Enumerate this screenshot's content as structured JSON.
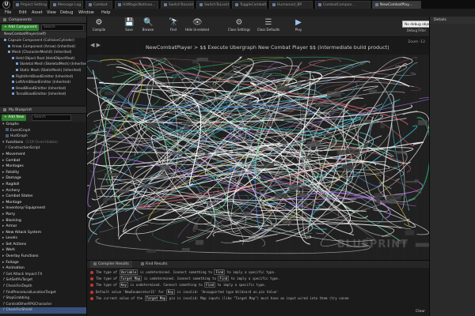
{
  "tabs": [
    {
      "label": "Project Settings",
      "active": false
    },
    {
      "label": "Message Log",
      "active": false
    },
    {
      "label": "Combat",
      "active": false
    },
    {
      "label": "HitMagicNotInvo...",
      "active": false
    },
    {
      "label": "SwitchToLockOn",
      "active": false
    },
    {
      "label": "SwitchToLockOff",
      "active": false
    },
    {
      "label": "ToggleCombatM...",
      "active": false
    },
    {
      "label": "Humanoid_BP",
      "active": false
    },
    {
      "label": "CombatCompon...",
      "active": false
    },
    {
      "label": "NewCombatPlay...",
      "active": true
    }
  ],
  "menu": [
    "File",
    "Edit",
    "Asset",
    "View",
    "Debug",
    "Window",
    "Help"
  ],
  "toolbar": [
    {
      "label": "Compile",
      "icon": "compile-icon"
    },
    {
      "label": "Save",
      "icon": "save-icon"
    },
    {
      "label": "Browse",
      "icon": "browse-icon"
    },
    {
      "label": "Find",
      "icon": "find-icon"
    },
    {
      "label": "Hide Unrelated",
      "icon": "hide-unrelated-icon"
    },
    {
      "label": "Class Settings",
      "icon": "class-settings-icon"
    },
    {
      "label": "Class Defaults",
      "icon": "class-defaults-icon"
    },
    {
      "label": "Play",
      "icon": "play-icon"
    }
  ],
  "debug": {
    "selected": "No debug object selected",
    "label": "Debug Filter"
  },
  "components": {
    "header": "Components",
    "add_button": "+ Add Component",
    "search_placeholder": "Search",
    "self": "NewCombatPlayer(self)",
    "tree": [
      {
        "label": "Capsule Component (CollisionCylinder)",
        "indent": 0
      },
      {
        "label": "Arrow Component (Arrow) (Inherited)",
        "indent": 1
      },
      {
        "label": "Mesh (CharacterMesh0) (Inherited)",
        "indent": 1
      },
      {
        "label": "Held Object Root (HeldObjectRoot)",
        "indent": 2
      },
      {
        "label": "Skeletal Mesh (SkeletalMesh) (Inherited)",
        "indent": 3
      },
      {
        "label": "Static Mesh (StaticMesh) (Inherited)",
        "indent": 3
      },
      {
        "label": "RightArmBloodEmitter (Inherited)",
        "indent": 2
      },
      {
        "label": "LeftArmBloodEmitter (Inherited)",
        "indent": 2
      },
      {
        "label": "HeadBloodEmitter (Inherited)",
        "indent": 2
      },
      {
        "label": "TorsoBloodEmitter (Inherited)",
        "indent": 2
      }
    ]
  },
  "my_blueprint": {
    "header": "My Blueprint",
    "add_button": "+ Add New",
    "search_placeholder": "Search",
    "graphs_label": "Graphs",
    "graphs": [
      "EventGraph",
      "HudGraph"
    ],
    "functions_label": "Functions",
    "functions_count": "(119 Overridable)",
    "function_items": [
      "ConstructionScript"
    ],
    "categories": [
      "Movement",
      "Combat",
      "Montages",
      "Fatality",
      "Damage",
      "Ragdoll",
      "Archery",
      "Combat States",
      "Montage",
      "Inventory/ Equipment",
      "Parry",
      "Blocking",
      "Armor",
      "New Attack System",
      "Levels",
      "Set Actions",
      "Work",
      "Overlay Functions",
      "Foliage",
      "Animation"
    ],
    "animation_functions": [
      "Get Attack Impact FX",
      "SetSelfAsTarget",
      "CheckForDepth",
      "FindProceduralLocationTarget",
      "StopGrabbing",
      "ControlOtherRPGCharacter",
      "CheckForShield"
    ]
  },
  "graph": {
    "title": "NewCombatPlayer > $$ Execute Ubergraph New Combat Player $$ (intermediate build product)",
    "zoom": "Zoom -12",
    "watermark": "BLUEPRINT"
  },
  "details": {
    "header": "Details"
  },
  "results": {
    "tabs": [
      "Compiler Results",
      "Find Results"
    ],
    "lines": [
      {
        "prefix": "The type of",
        "pill": "Variable",
        "suffix": "is undetermined.  Connect something to",
        "pill2": "Find",
        "suffix2": "to imply a specific type."
      },
      {
        "prefix": "The type of",
        "pill": "Target Map",
        "suffix": "is undetermined.  Connect something to",
        "pill2": "Find",
        "suffix2": "to imply a specific type."
      },
      {
        "prefix": "The type of",
        "pill": "Key",
        "suffix": "is undetermined.  Connect something to",
        "pill2": "Find",
        "suffix2": "to imply a specific type."
      },
      {
        "prefix": "Default value 'NewEnumerator15' for",
        "pill": "Key",
        "suffix": "is invalid: 'Unsupported type Wildcard on pin Value'",
        "pill2": "",
        "suffix2": ""
      },
      {
        "prefix": "The current value of the",
        "pill": "Target Map",
        "suffix": "pin is invalid: Map inputs (like \"Target Map\") must have an input wired into them (try conne",
        "pill2": "",
        "suffix2": ""
      }
    ],
    "clear_label": "Clear"
  }
}
